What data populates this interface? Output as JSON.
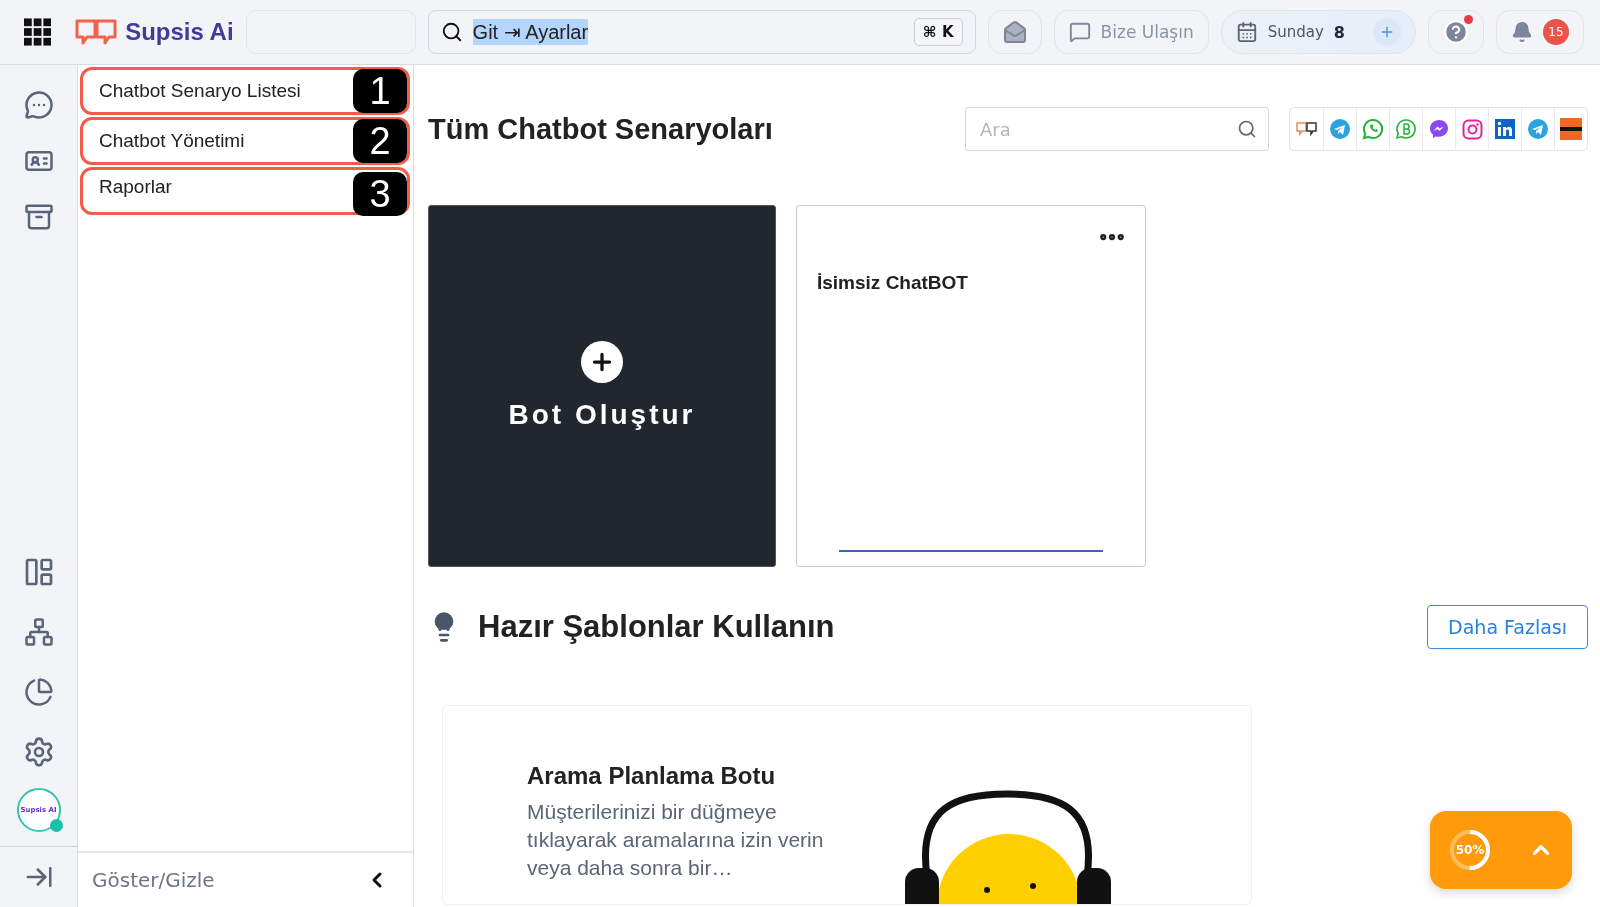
{
  "app": {
    "logo": "Supsis Ai"
  },
  "search": {
    "value": "Git ⇥ Ayarlar",
    "shortcut": "⌘ K"
  },
  "header": {
    "contact": "Bize Ulaşın",
    "calendar_day": "Sunday",
    "calendar_date": "8",
    "help_dot": true,
    "notifications": "15"
  },
  "rail": {
    "avatar_label": "Supsis AI",
    "avatar_online": true
  },
  "sidebar": {
    "items": [
      {
        "label": "Chatbot Senaryo Listesi",
        "marker": "1"
      },
      {
        "label": "Chatbot Yönetimi",
        "marker": "2"
      },
      {
        "label": "Raporlar",
        "marker": "3"
      }
    ],
    "footer": "Göster/Gizle"
  },
  "page": {
    "title": "Tüm Chatbot Senaryoları",
    "search_placeholder": "Ara",
    "channels": [
      {
        "kind": "supsis"
      },
      {
        "kind": "telegram"
      },
      {
        "kind": "whatsapp"
      },
      {
        "kind": "whatsapp-business"
      },
      {
        "kind": "messenger"
      },
      {
        "kind": "instagram"
      },
      {
        "kind": "linkedin"
      },
      {
        "kind": "telegram"
      },
      {
        "kind": "marketplace"
      }
    ]
  },
  "bots": [
    {
      "kind": "create",
      "label": "Bot Oluştur"
    },
    {
      "kind": "bot",
      "name": "İsimsiz ChatBOT"
    }
  ],
  "templates": {
    "title": "Hazır Şablonlar Kullanın",
    "more": "Daha Fazlası",
    "cards": [
      {
        "title": "Arama Planlama Botu",
        "description": "Müşterilerinizi bir düğmeye tıklayarak aramalarına izin verin veya daha sonra bir…"
      }
    ]
  },
  "progress": {
    "label": "50%",
    "level": 0.5
  }
}
